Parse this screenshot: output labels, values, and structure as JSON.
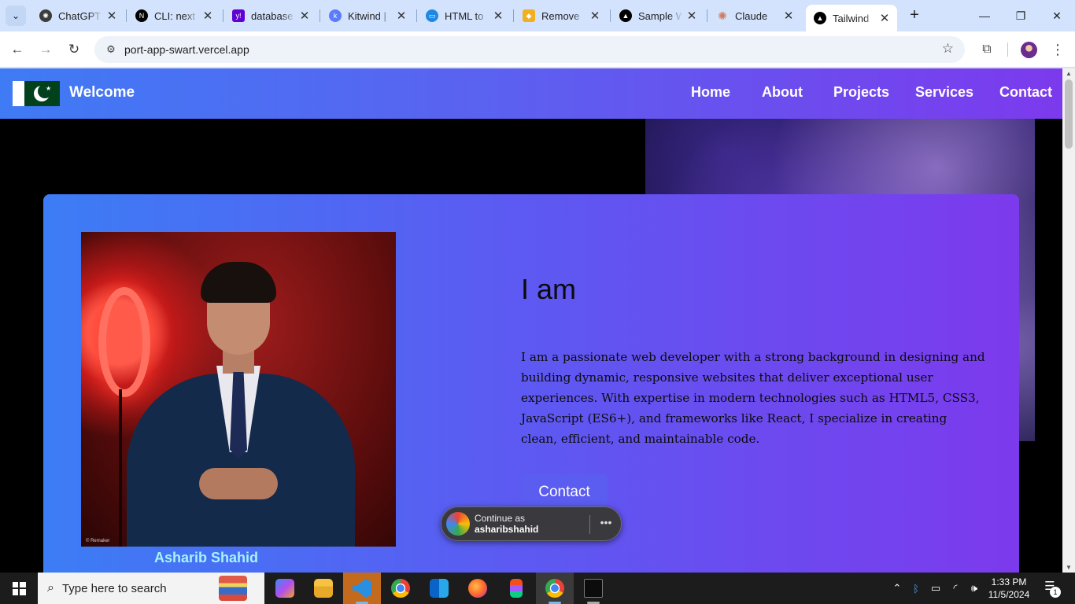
{
  "browser": {
    "tabs": [
      {
        "title": "ChatGPT",
        "icon": "chatgpt-icon",
        "color": "#3c3c3c"
      },
      {
        "title": "CLI: next",
        "icon": "nextjs-icon",
        "color": "#000000"
      },
      {
        "title": "database",
        "icon": "yahoo-icon",
        "color": "#6001d2"
      },
      {
        "title": "Kitwind |",
        "icon": "kitwind-icon",
        "color": "#5b7cfa"
      },
      {
        "title": "HTML to",
        "icon": "html-converter-icon",
        "color": "#1e88e5"
      },
      {
        "title": "Remove",
        "icon": "remove-bg-icon",
        "color": "#f2b01e"
      },
      {
        "title": "Sample W",
        "icon": "vercel-icon",
        "color": "#000000"
      },
      {
        "title": "Claude",
        "icon": "claude-icon",
        "color": "#d97757"
      },
      {
        "title": "Tailwind",
        "icon": "vercel-icon",
        "color": "#000000",
        "active": true
      }
    ],
    "url": "port-app-swart.vercel.app"
  },
  "page": {
    "nav": {
      "brand": "Welcome",
      "links": [
        "Home",
        "About",
        "Projects",
        "Services",
        "Contact"
      ]
    },
    "hero": {
      "title": "I am",
      "text": "I am a passionate web developer with a strong background in designing and building dynamic, responsive websites that deliver exceptional user experiences. With expertise in modern technologies such as HTML5, CSS3, JavaScript (ES6+), and frameworks like React, I specialize in creating clean, efficient, and maintainable code.",
      "button": "Contact",
      "name": "Asharib Shahid",
      "photo_watermark": "© Remaker"
    },
    "google_onetap": {
      "line1": "Continue as",
      "line2": "asharibshahid"
    }
  },
  "taskbar": {
    "search_placeholder": "Type here to search",
    "apps": [
      "copilot-icon",
      "file-explorer-icon",
      "vscode-icon",
      "chrome-icon",
      "outlook-icon",
      "firefox-icon",
      "figma-icon",
      "chrome-profile-icon",
      "terminal-icon"
    ],
    "time": "1:33 PM",
    "date": "11/5/2024",
    "notifications": "1"
  },
  "colors": {
    "nav_gradient_start": "#3f7bf5",
    "nav_gradient_end": "#7c3aed",
    "name_color": "#a5f3fc",
    "button_bg": "#5b5cf0"
  }
}
